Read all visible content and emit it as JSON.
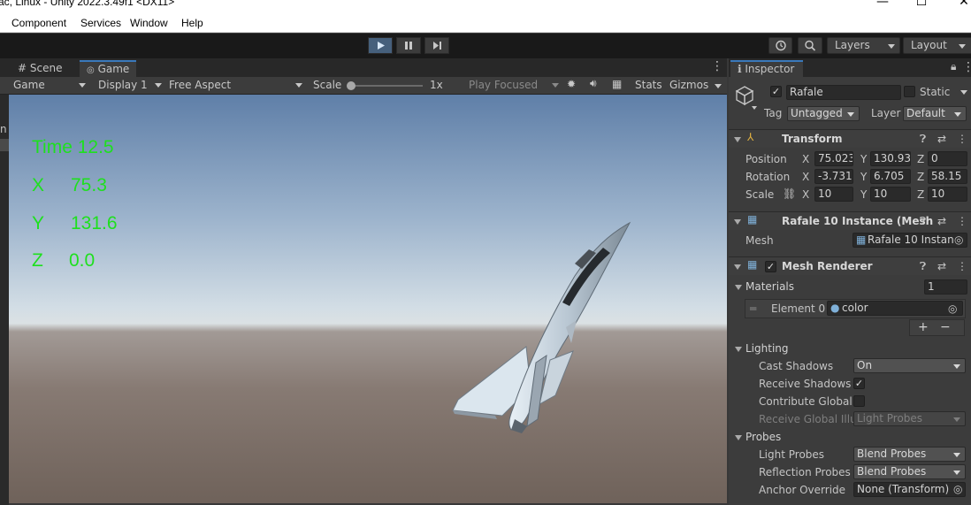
{
  "titlebar": {
    "title": "ac, Linux - Unity 2022.3.49f1 <DX11>",
    "minimize": "—",
    "maximize": "☐",
    "close": "✕"
  },
  "menu": [
    "Component",
    "Services",
    "Window",
    "Help"
  ],
  "toolbar": {
    "layers": "Layers",
    "layout": "Layout",
    "history_icon": "history-icon",
    "search_icon": "search-icon"
  },
  "tabs": {
    "scene": "Scene",
    "game": "Game"
  },
  "game_toolbar": {
    "display_mode": "Game",
    "display": "Display 1",
    "aspect": "Free Aspect",
    "scale_label": "Scale",
    "scale_value": "1x",
    "scale_level": 0.0,
    "play_focused": "Play Focused",
    "stats": "Stats",
    "gizmos": "Gizmos"
  },
  "hud": {
    "time": "Time 12.5",
    "x_label": "X",
    "x_value": "75.3",
    "y_label": "Y",
    "y_value": "131.6",
    "z_label": "Z",
    "z_value": "0.0"
  },
  "left_strip": {
    "letter": "n"
  },
  "inspector": {
    "tab": "Inspector",
    "object_name": "Rafale",
    "active": true,
    "static_label": "Static",
    "tag_label": "Tag",
    "tag_value": "Untagged",
    "layer_label": "Layer",
    "layer_value": "Default",
    "transform": {
      "title": "Transform",
      "position_label": "Position",
      "position": {
        "x": "75.023",
        "y": "130.93",
        "z": "0"
      },
      "rotation_label": "Rotation",
      "rotation": {
        "x": "-3.731",
        "y": "6.705",
        "z": "58.15"
      },
      "scale_label": "Scale",
      "scale": {
        "x": "10",
        "y": "10",
        "z": "10"
      }
    },
    "mesh_filter": {
      "title": "Rafale 10 Instance (Mesh",
      "mesh_label": "Mesh",
      "mesh_value": "Rafale 10 Instanc"
    },
    "mesh_renderer": {
      "title": "Mesh Renderer",
      "enabled": true,
      "materials_label": "Materials",
      "materials_count": "1",
      "element0_label": "Element 0",
      "element0_value": "color",
      "add": "+",
      "remove": "−",
      "lighting_label": "Lighting",
      "cast_shadows_label": "Cast Shadows",
      "cast_shadows_value": "On",
      "receive_shadows_label": "Receive Shadows",
      "receive_shadows": true,
      "contribute_gi_label": "Contribute Global I",
      "contribute_gi": false,
      "receive_gi_label": "Receive Global Illu",
      "receive_gi_value": "Light Probes",
      "probes_label": "Probes",
      "light_probes_label": "Light Probes",
      "light_probes_value": "Blend Probes",
      "reflection_probes_label": "Reflection Probes",
      "reflection_probes_value": "Blend Probes",
      "anchor_override_label": "Anchor Override",
      "anchor_override_value": "None (Transform)"
    }
  },
  "colors": {
    "hud_green": "#1ee01e",
    "play_active": "#46607c",
    "tab_accent": "#3a79bb"
  }
}
